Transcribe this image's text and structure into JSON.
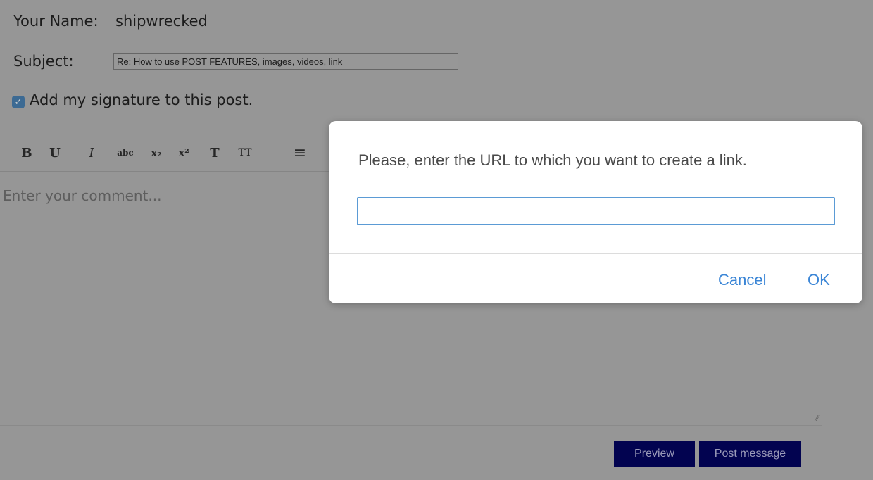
{
  "form": {
    "name_label": "Your Name:",
    "name_value": "shipwrecked",
    "subject_label": "Subject:",
    "subject_value": "Re: How to use POST FEATURES, images, videos, link",
    "signature_checked": true,
    "signature_label": "Add my signature to this post.",
    "comment_placeholder": "Enter your comment...",
    "preview_label": "Preview",
    "post_label": "Post message"
  },
  "toolbar": {
    "buttons": [
      {
        "name": "bold-button",
        "glyph": "B"
      },
      {
        "name": "underline-button",
        "glyph": "U"
      },
      {
        "name": "italic-button",
        "glyph": "I"
      },
      {
        "name": "strikethrough-button",
        "glyph": "abc"
      },
      {
        "name": "subscript-button",
        "glyph": "x₂"
      },
      {
        "name": "superscript-button",
        "glyph": "x²"
      },
      {
        "name": "text-color-button",
        "glyph": "T"
      },
      {
        "name": "font-size-button",
        "glyph": "TT"
      },
      {
        "name": "align-button",
        "glyph": "≡"
      }
    ]
  },
  "dialog": {
    "message": "Please, enter the URL to which you want to create a link.",
    "url_value": "",
    "cancel_label": "Cancel",
    "ok_label": "OK"
  },
  "colors": {
    "overlay": "#969696",
    "button_bg": "#020350",
    "link_blue": "#3a85d6",
    "input_focus": "#5b9bd5"
  }
}
